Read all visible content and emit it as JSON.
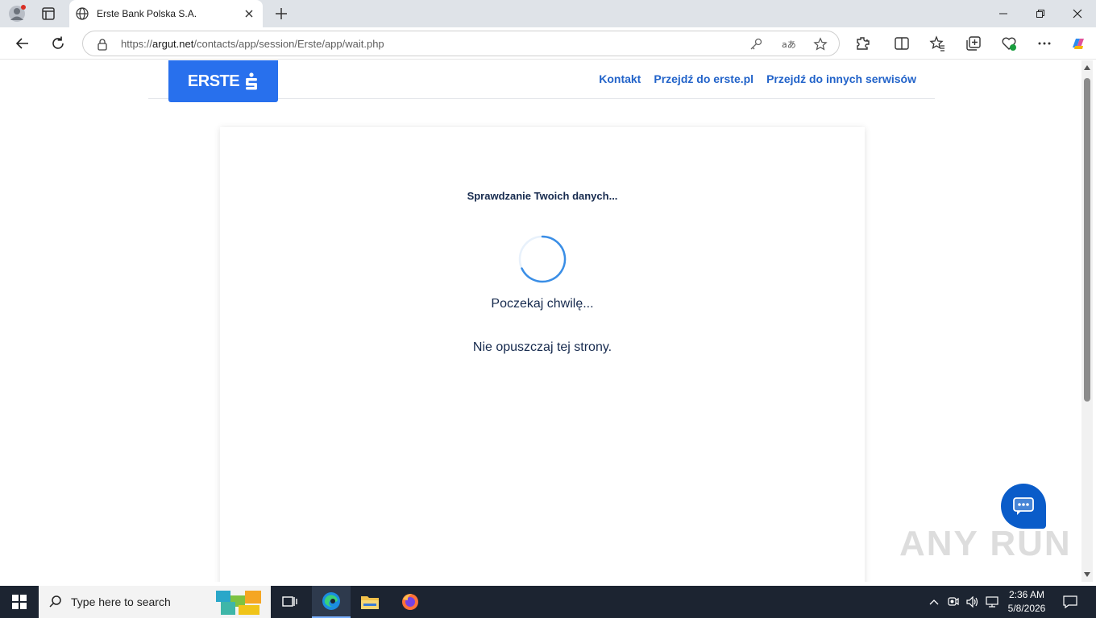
{
  "browser": {
    "tab_title": "Erste Bank Polska S.A.",
    "url_prefix": "https://",
    "url_domain": "argut.net",
    "url_path": "/contacts/app/session/Erste/app/wait.php"
  },
  "page": {
    "logo_text": "ERSTE",
    "nav_links": [
      "Kontakt",
      "Przejdź do erste.pl",
      "Przejdź do innych serwisów"
    ],
    "heading": "Sprawdzanie Twoich danych...",
    "wait_text": "Poczekaj chwilę...",
    "warning_text": "Nie opuszczaj tej strony."
  },
  "watermark": "ANY RUN",
  "taskbar": {
    "search_placeholder": "Type here to search",
    "time": "2:36 AM",
    "date": "5/8/2026"
  },
  "colors": {
    "brand_blue": "#2870ed",
    "link_blue": "#2263c9",
    "text_navy": "#162a4e",
    "chat_blue": "#0a5cc9"
  }
}
